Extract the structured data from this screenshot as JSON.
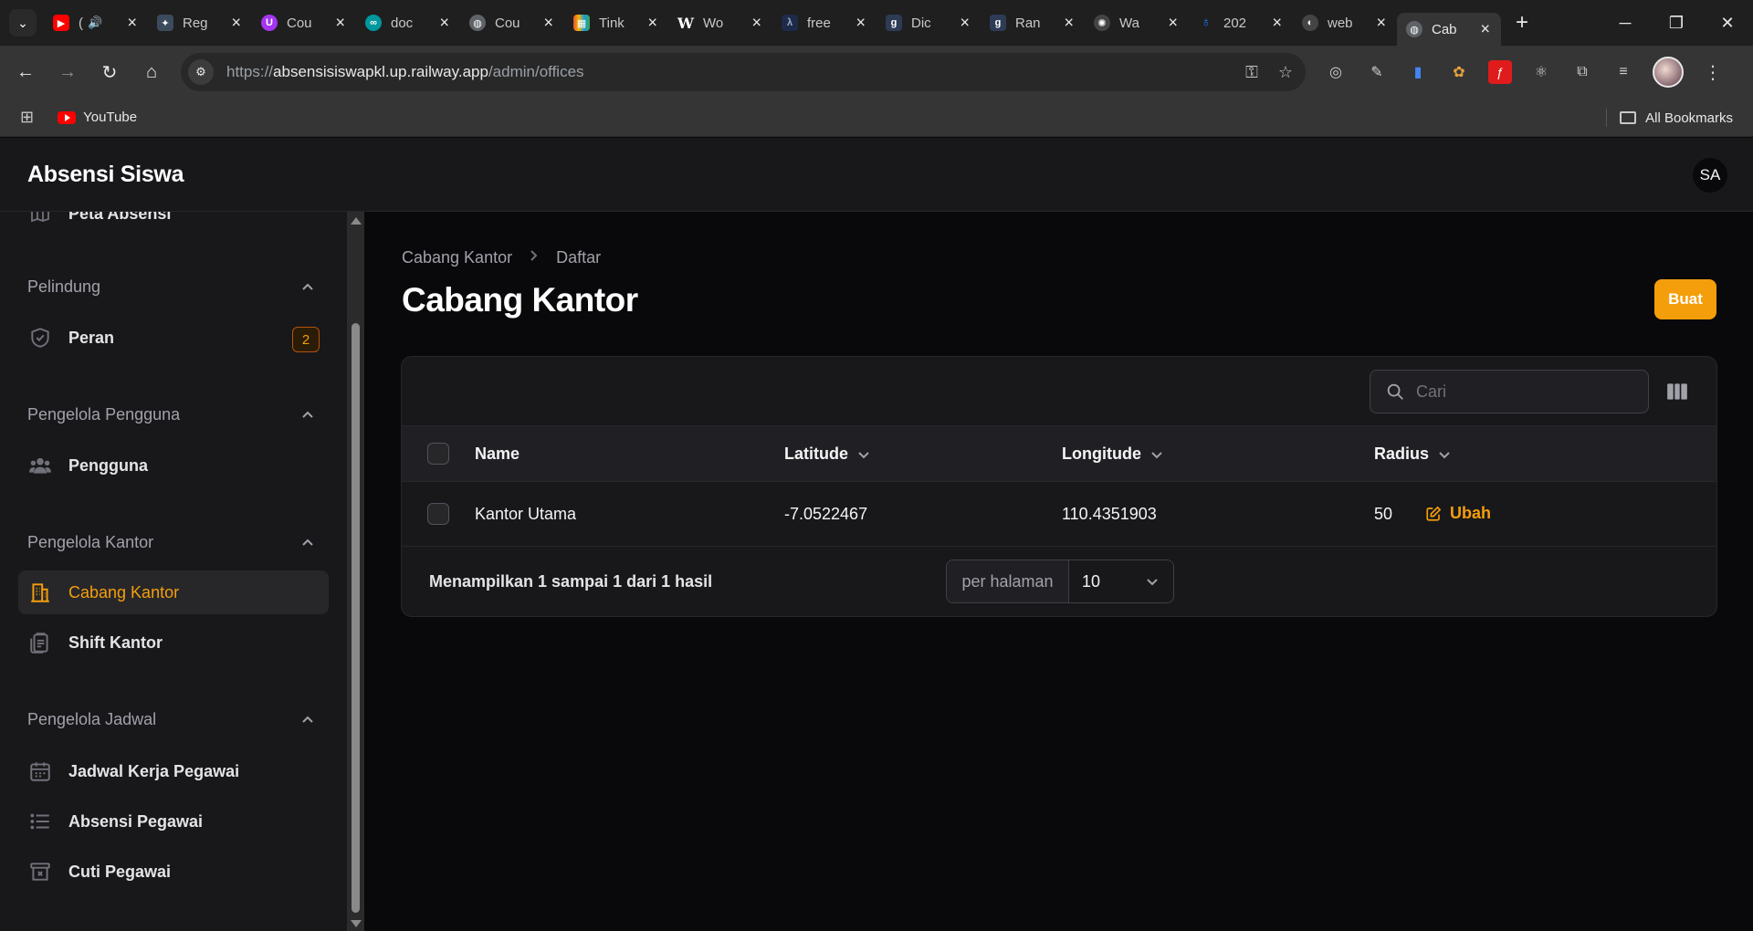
{
  "browser": {
    "tabs": [
      {
        "label": "(",
        "favicon": "youtube-icon",
        "color": "#ff0000",
        "audio": true
      },
      {
        "label": "Reg",
        "favicon": "colab-icon",
        "color": "#3b4a5c"
      },
      {
        "label": "Cou",
        "favicon": "udemy-icon",
        "color": "#a435f0"
      },
      {
        "label": "doc",
        "favicon": "arduino-icon",
        "color": "#00979d"
      },
      {
        "label": "Cou",
        "favicon": "globe-icon",
        "color": "#5f6368"
      },
      {
        "label": "Tink",
        "favicon": "tinkercad-icon",
        "color": "#e2562f"
      },
      {
        "label": "Wo",
        "favicon": "wikipedia-icon",
        "color": "#ffffff"
      },
      {
        "label": "free",
        "favicon": "lambda-icon",
        "color": "#1e2a4a"
      },
      {
        "label": "Dic",
        "favicon": "g-icon",
        "color": "#2d3b55"
      },
      {
        "label": "Ran",
        "favicon": "g-icon",
        "color": "#2d3b55"
      },
      {
        "label": "Wa",
        "favicon": "openai-icon",
        "color": "#444444"
      },
      {
        "label": "202",
        "favicon": "person-icon",
        "color": "#1a73e8"
      },
      {
        "label": "web",
        "favicon": "web-icon",
        "color": "#444444"
      },
      {
        "label": "Cab",
        "favicon": "globe-icon",
        "color": "#5f6368",
        "active": true
      }
    ],
    "url_scheme": "https://",
    "url_host": "absensisiswapkl.up.railway.app",
    "url_path": "/admin/offices",
    "bookmark_youtube": "YouTube",
    "all_bookmarks": "All Bookmarks"
  },
  "app": {
    "brand": "Absensi Siswa",
    "avatar_initials": "SA"
  },
  "sidebar": {
    "partial_item": "Peta Absensi",
    "groups": [
      {
        "label": "Pelindung",
        "items": [
          {
            "label": "Peran",
            "badge": "2",
            "icon": "shield-check-icon"
          }
        ]
      },
      {
        "label": "Pengelola Pengguna",
        "items": [
          {
            "label": "Pengguna",
            "icon": "users-icon"
          }
        ]
      },
      {
        "label": "Pengelola Kantor",
        "items": [
          {
            "label": "Cabang Kantor",
            "icon": "building-office-icon",
            "active": true
          },
          {
            "label": "Shift Kantor",
            "icon": "clipboard-icon"
          }
        ]
      },
      {
        "label": "Pengelola Jadwal",
        "items": [
          {
            "label": "Jadwal Kerja Pegawai",
            "icon": "calendar-icon"
          },
          {
            "label": "Absensi Pegawai",
            "icon": "list-icon"
          },
          {
            "label": "Cuti Pegawai",
            "icon": "archive-icon"
          }
        ]
      }
    ]
  },
  "main": {
    "breadcrumbs": [
      "Cabang Kantor",
      "Daftar"
    ],
    "title": "Cabang Kantor",
    "create_label": "Buat",
    "search_placeholder": "Cari",
    "columns": [
      "Name",
      "Latitude",
      "Longitude",
      "Radius"
    ],
    "rows": [
      {
        "name": "Kantor Utama",
        "latitude": "-7.0522467",
        "longitude": "110.4351903",
        "radius": "50",
        "action": "Ubah"
      }
    ],
    "summary": "Menampilkan 1 sampai 1 dari 1 hasil",
    "per_page_label": "per halaman",
    "per_page_value": "10"
  },
  "colors": {
    "accent": "#f59e0b",
    "background": "#09090b",
    "panel": "#18181b"
  }
}
